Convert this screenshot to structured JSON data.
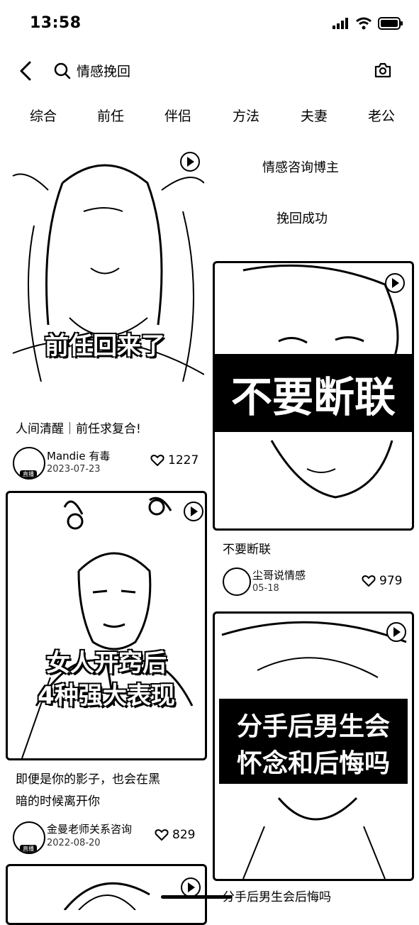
{
  "status_bar": {
    "time": "13:58"
  },
  "header": {
    "query": "情感挽回"
  },
  "tabs": [
    "综合",
    "前任",
    "伴侣",
    "方法",
    "夫妻",
    "老公"
  ],
  "left_cards": [
    {
      "cover_text": "前任回来了",
      "title": "人间清醒｜前任求复合!",
      "author": "Mandie 有毒",
      "date": "2023-07-23",
      "likes": "1227",
      "live_badge": "直播"
    },
    {
      "cover_text_1": "女人开窍后",
      "cover_text_2": "4种强大表现",
      "title_1": "即便是你的影子，也会在黑",
      "title_2": "暗的时候离开你",
      "author": "金曼老师关系咨询",
      "date": "2022-08-20",
      "likes": "829",
      "live_badge": "直播"
    }
  ],
  "right_cards": [
    {
      "text_1": "情感咨询博主",
      "text_2": "挽回成功"
    },
    {
      "cover_text": "不要断联",
      "title": "不要断联",
      "author": "尘哥说情感",
      "date": "05-18",
      "likes": "979"
    },
    {
      "cover_text_1": "分手后男生会",
      "cover_text_2": "怀念和后悔吗",
      "title": "分手后男生会后悔吗"
    }
  ]
}
